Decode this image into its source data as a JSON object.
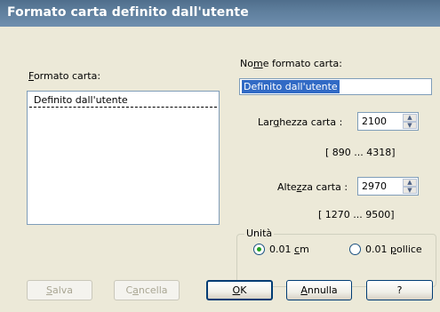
{
  "window": {
    "title": "Formato carta definito dall'utente"
  },
  "left": {
    "list_label_u": "F",
    "list_label_rest": "ormato carta:",
    "list_items": [
      "Definito dall'utente"
    ]
  },
  "right": {
    "name_label_a": "No",
    "name_label_u": "m",
    "name_label_b": "e formato carta:",
    "name_value": "Definito dall'utente",
    "width_label_a": "Lar",
    "width_label_u": "g",
    "width_label_b": "hezza carta :",
    "width_value": "2100",
    "width_range": "[ 890 ...  4318]",
    "height_label_a": "Alte",
    "height_label_u": "z",
    "height_label_b": "za carta :",
    "height_value": "2970",
    "height_range": "[ 1270 ...  9500]"
  },
  "units": {
    "title": "Unità",
    "cm_a": "0.01 ",
    "cm_u": "c",
    "cm_b": "m",
    "inch_a": "0.01 ",
    "inch_u": "p",
    "inch_b": "ollice",
    "selected": "cm"
  },
  "buttons": {
    "save_u": "S",
    "save_rest": "alva",
    "delete_a": "C",
    "delete_u": "a",
    "delete_b": "ncella",
    "ok_u": "O",
    "ok_rest": "K",
    "cancel_u": "A",
    "cancel_rest": "nnulla",
    "help": "?"
  }
}
